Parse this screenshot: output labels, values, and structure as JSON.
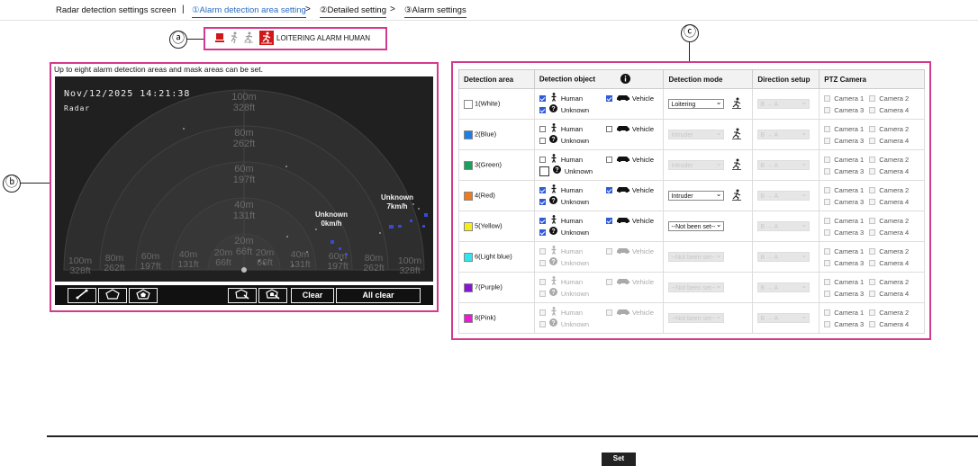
{
  "header": {
    "title": "Radar detection settings screen",
    "separator": "|",
    "steps": [
      {
        "label": "①Alarm detection area setting",
        "active": true
      },
      {
        "label": "②Detailed setting",
        "active": false
      },
      {
        "label": "③Alarm settings",
        "active": false
      }
    ],
    "arrow": ">"
  },
  "callouts": {
    "a": "ⓐ",
    "b": "ⓑ",
    "c": "ⓒ"
  },
  "status_bar": {
    "label": "LOITERING ALARM HUMAN",
    "icons": [
      "alarm-lamp-icon",
      "walking-person-icon",
      "running-person-icon",
      "loitering-alarm-icon"
    ]
  },
  "radar_panel": {
    "note": "Up to eight alarm detection areas and mask areas can be set.",
    "timestamp": "Nov/12/2025 14:21:38",
    "label": "Radar",
    "range_labels": [
      {
        "m": "100m",
        "ft": "328ft"
      },
      {
        "m": "80m",
        "ft": "262ft"
      },
      {
        "m": "60m",
        "ft": "197ft"
      },
      {
        "m": "40m",
        "ft": "131ft"
      },
      {
        "m": "20m",
        "ft": "66ft"
      }
    ],
    "bottom_labels": [
      "100m 328ft",
      "80m 262ft",
      "60m 197ft",
      "40m 131ft",
      "20m 66ft",
      "20m 66ft",
      "40m 131ft",
      "60m 197ft",
      "80m 262ft",
      "100m 328ft"
    ],
    "targets": [
      {
        "name": "Unknown",
        "speed": "0km/h"
      },
      {
        "name": "Unknown",
        "speed": "7km/h"
      }
    ],
    "toolbar": {
      "line_tool": "line-draw-icon",
      "polygon_tool": "polygon-area-icon",
      "mask_tool": "mask-area-icon",
      "edit_tool": "edit-area-icon",
      "edit_mask_tool": "edit-mask-icon",
      "clear": "Clear",
      "all_clear": "All clear"
    }
  },
  "table": {
    "headers": {
      "area": "Detection area",
      "object": "Detection object",
      "mode": "Detection mode",
      "direction": "Direction setup",
      "ptz": "PTZ Camera"
    },
    "object_labels": {
      "human": "Human",
      "vehicle": "Vehicle",
      "unknown": "Unknown"
    },
    "direction_placeholder": "B → A",
    "cameras": [
      "Camera 1",
      "Camera 2",
      "Camera 3",
      "Camera 4"
    ],
    "rows": [
      {
        "area": "1(White)",
        "color": "#ffffff",
        "human": "on",
        "vehicle": "on",
        "unknown": "on",
        "mode": "Loitering",
        "mode_enabled": true,
        "mode_icon": true
      },
      {
        "area": "2(Blue)",
        "color": "#1a7fe8",
        "human": "off",
        "vehicle": "off",
        "unknown": "off",
        "mode": "Intruder",
        "mode_enabled": false,
        "mode_icon": true
      },
      {
        "area": "3(Green)",
        "color": "#1aa05a",
        "human": "off",
        "vehicle": "off",
        "unknown": "focus",
        "mode": "Intruder",
        "mode_enabled": false,
        "mode_icon": true
      },
      {
        "area": "4(Red)",
        "color": "#f07a1e",
        "human": "on",
        "vehicle": "on",
        "unknown": "on",
        "mode": "Intruder",
        "mode_enabled": true,
        "mode_icon": true
      },
      {
        "area": "5(Yellow)",
        "color": "#f5ee1a",
        "human": "on",
        "vehicle": "on",
        "unknown": "on",
        "mode": "--Not been set--",
        "mode_enabled": true,
        "mode_icon": false
      },
      {
        "area": "6(Light blue)",
        "color": "#2ee6f0",
        "human": "dis",
        "vehicle": "dis",
        "unknown": "dis",
        "mode": "--Not been set--",
        "mode_enabled": false,
        "mode_icon": false
      },
      {
        "area": "7(Purple)",
        "color": "#8a14d4",
        "human": "dis",
        "vehicle": "dis",
        "unknown": "dis",
        "mode": "--Not been set--",
        "mode_enabled": false,
        "mode_icon": false
      },
      {
        "area": "8(Pink)",
        "color": "#ee18d8",
        "human": "dis",
        "vehicle": "dis",
        "unknown": "dis",
        "mode": "--Not been set--",
        "mode_enabled": false,
        "mode_icon": false
      }
    ]
  },
  "footer": {
    "set_button": "Set"
  }
}
